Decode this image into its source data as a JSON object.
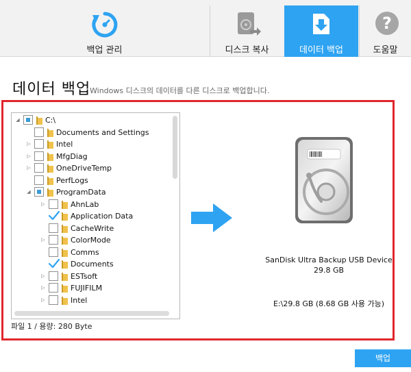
{
  "tabs": [
    {
      "label": "백업 관리",
      "icon": "backup-refresh-icon",
      "active": false
    },
    {
      "label": "디스크 복사",
      "icon": "disk-copy-icon",
      "active": false
    },
    {
      "label": "데이터 백업",
      "icon": "download-box-icon",
      "active": true
    },
    {
      "label": "도움말",
      "icon": "help-question-icon",
      "active": false
    }
  ],
  "heading": {
    "title": "데이터 백업",
    "subtitle": "Windows 디스크의 데이터를 다른 디스크로 백업합니다."
  },
  "tree": {
    "items": [
      {
        "name": "C:\\",
        "expander": "expanded",
        "check": "partial",
        "level": 0
      },
      {
        "name": "Documents and Settings",
        "expander": "none",
        "check": "unchecked",
        "level": 1
      },
      {
        "name": "Intel",
        "expander": "collapsed",
        "check": "unchecked",
        "level": 1
      },
      {
        "name": "MfgDiag",
        "expander": "collapsed",
        "check": "unchecked",
        "level": 1
      },
      {
        "name": "OneDriveTemp",
        "expander": "collapsed",
        "check": "unchecked",
        "level": 1
      },
      {
        "name": "PerfLogs",
        "expander": "none",
        "check": "unchecked",
        "level": 1
      },
      {
        "name": "ProgramData",
        "expander": "expanded",
        "check": "partial",
        "level": 1
      },
      {
        "name": "AhnLab",
        "expander": "collapsed",
        "check": "unchecked",
        "level": 2
      },
      {
        "name": "Application Data",
        "expander": "none",
        "check": "checked",
        "level": 2
      },
      {
        "name": "CacheWrite",
        "expander": "none",
        "check": "unchecked",
        "level": 2
      },
      {
        "name": "ColorMode",
        "expander": "collapsed",
        "check": "unchecked",
        "level": 2
      },
      {
        "name": "Comms",
        "expander": "none",
        "check": "unchecked",
        "level": 2
      },
      {
        "name": "Documents",
        "expander": "none",
        "check": "checked",
        "level": 2
      },
      {
        "name": "ESTsoft",
        "expander": "collapsed",
        "check": "unchecked",
        "level": 2
      },
      {
        "name": "FUJIFILM",
        "expander": "collapsed",
        "check": "unchecked",
        "level": 2
      },
      {
        "name": "Intel",
        "expander": "collapsed",
        "check": "unchecked",
        "level": 2
      }
    ]
  },
  "status": "파일 1 / 용량: 280 Byte",
  "target": {
    "device_name": "SanDisk Ultra Backup USB Device",
    "device_size": "29.8 GB",
    "free_space": "E:\\29.8 GB (8.68 GB 사용 가능)"
  },
  "backup_button": "백업",
  "colors": {
    "accent": "#2ea3f2",
    "highlight_border": "#e0262b",
    "folder": "#f0c24b"
  }
}
